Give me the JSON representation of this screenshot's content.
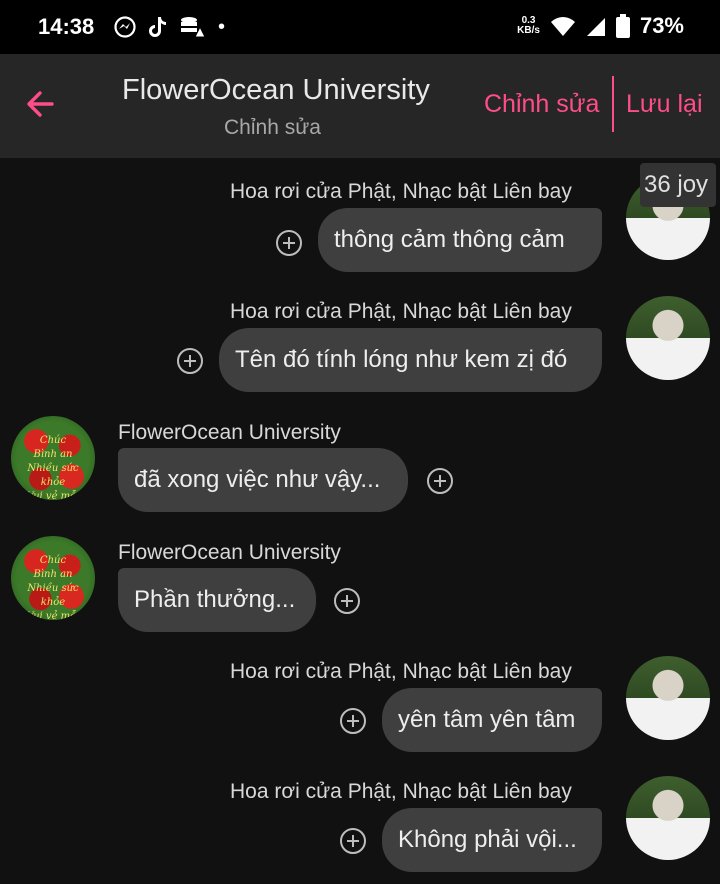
{
  "status_bar": {
    "time": "14:38",
    "speed_top": "0.3",
    "speed_unit": "KB/s",
    "battery_percent": "73%"
  },
  "header": {
    "title": "FlowerOcean University",
    "subtitle": "Chỉnh sửa",
    "edit_label": "Chỉnh sửa",
    "save_label": "Lưu lại"
  },
  "badge": {
    "text": "36 joy"
  },
  "messages": [
    {
      "sender": "Hoa rơi cửa Phật, Nhạc bật Liên bay",
      "text": "thông cảm thông cảm"
    },
    {
      "sender": "Hoa rơi cửa Phật, Nhạc bật Liên bay",
      "text": "Tên đó tính lóng như kem zị đó"
    },
    {
      "sender": "FlowerOcean University",
      "text": "đã xong việc như vậy..."
    },
    {
      "sender": "FlowerOcean University",
      "text": "Phần thưởng..."
    },
    {
      "sender": "Hoa rơi cửa Phật, Nhạc bật Liên bay",
      "text": "yên tâm yên tâm"
    },
    {
      "sender": "Hoa rơi cửa Phật, Nhạc bật Liên bay",
      "text": "Không phải vội..."
    }
  ],
  "avatar_text": {
    "line1": "Chúc",
    "line2": "Bình an",
    "line3": "Nhiều sức khỏe",
    "line4": "Vui vẻ mỗi ngày"
  },
  "colors": {
    "accent": "#ff4d88",
    "bubble": "#3f3f3f",
    "background": "#111111",
    "header": "#262626"
  }
}
